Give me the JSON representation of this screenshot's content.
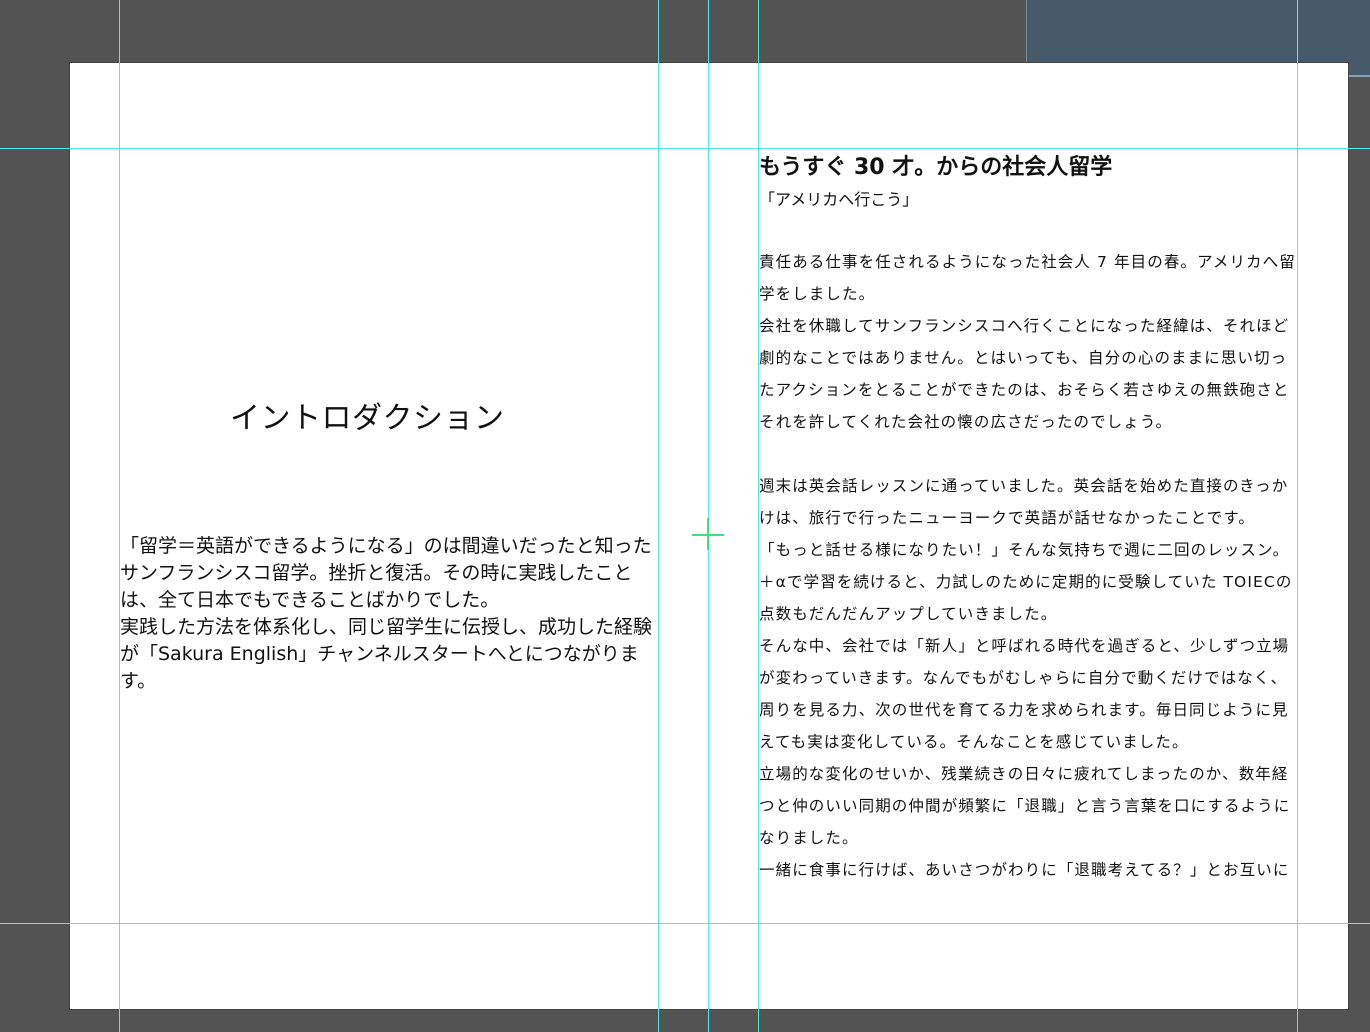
{
  "left_page": {
    "title": "イントロダクション",
    "paragraphs": [
      "「留学＝英語ができるようになる」のは間違いだったと知ったサンフランシスコ留学。挫折と復活。その時に実践したことは、全て日本でもできることばかりでした。",
      "実践した方法を体系化し、同じ留学生に伝授し、成功した経験が「Sakura English」チャンネルスタートへとにつながります。"
    ]
  },
  "right_page": {
    "title": "もうすぐ 30 才。からの社会人留学",
    "subtitle": "「アメリカへ行こう」",
    "paragraphs": [
      "責任ある仕事を任されるようになった社会人 7 年目の春。アメリカへ留学をしました。",
      "会社を休職してサンフランシスコへ行くことになった経緯は、それほど劇的なことではありません。とはいっても、自分の心のままに思い切ったアクションをとることができたのは、おそらく若さゆえの無鉄砲さとそれを許してくれた会社の懐の広さだったのでしょう。",
      "",
      "週末は英会話レッスンに通っていました。英会話を始めた直接のきっかけは、旅行で行ったニューヨークで英語が話せなかったことです。",
      "「もっと話せる様になりたい！」そんな気持ちで週に二回のレッスン。＋αで学習を続けると、力試しのために定期的に受験していた TOIECの点数もだんだんアップしていきました。",
      "そんな中、会社では「新人」と呼ばれる時代を過ぎると、少しずつ立場が変わっていきます。なんでもがむしゃらに自分で動くだけではなく、周りを見る力、次の世代を育てる力を求められます。毎日同じように見えても実は変化している。そんなことを感じていました。",
      "立場的な変化のせいか、残業続きの日々に疲れてしまったのか、数年経つと仲のいい同期の仲間が頻繁に「退職」と言う言葉を口にするようになりました。",
      "一緒に食事に行けば、あいさつがわりに「退職考えてる？」とお互いに"
    ]
  }
}
